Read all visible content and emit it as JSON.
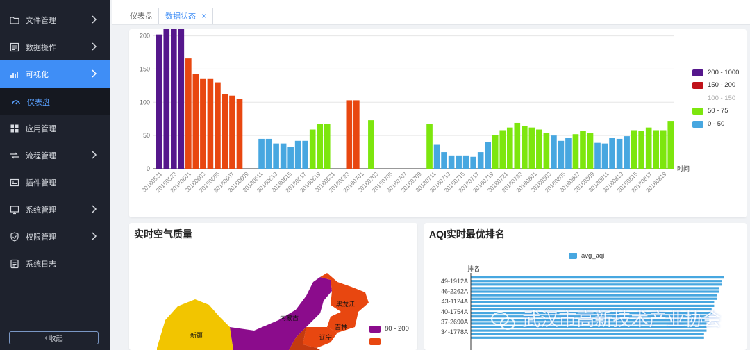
{
  "sidebar": {
    "items": [
      {
        "label": "文件管理",
        "icon": "folder-icon",
        "has_children": true
      },
      {
        "label": "数据操作",
        "icon": "data-op-icon",
        "has_children": true
      },
      {
        "label": "可视化",
        "icon": "bar-chart-icon",
        "has_children": true
      },
      {
        "label": "仪表盘",
        "icon": "dashboard-icon",
        "has_children": false
      },
      {
        "label": "应用管理",
        "icon": "grid-icon",
        "has_children": false
      },
      {
        "label": "流程管理",
        "icon": "flow-icon",
        "has_children": true
      },
      {
        "label": "插件管理",
        "icon": "plugin-icon",
        "has_children": false
      },
      {
        "label": "系统管理",
        "icon": "monitor-icon",
        "has_children": true
      },
      {
        "label": "权限管理",
        "icon": "shield-icon",
        "has_children": true
      },
      {
        "label": "系统日志",
        "icon": "log-icon",
        "has_children": false
      }
    ],
    "collapse_label": "收起"
  },
  "tabs": [
    {
      "label": "仪表盘",
      "active": false
    },
    {
      "label": "数据状态",
      "active": true,
      "close": "×"
    }
  ],
  "top_chart": {
    "x_axis_name": "时间",
    "legend": [
      {
        "label": "200 - 1000",
        "color": "#55178c"
      },
      {
        "label": "150 - 200",
        "color": "#c0121a"
      },
      {
        "label": "100 - 150",
        "color": "",
        "dimmed": true
      },
      {
        "label": "50 - 75",
        "color": "#7de60e"
      },
      {
        "label": "0 - 50",
        "color": "#47a7e0"
      }
    ]
  },
  "chart_data": {
    "type": "bar",
    "ylim": [
      0,
      210
    ],
    "yticks": [
      0,
      50,
      100,
      150,
      200
    ],
    "xlabel": "时间",
    "grid": true,
    "legend_position": "right",
    "xtick_labels": [
      "20180521",
      "20180523",
      "20180601",
      "20180603",
      "20180605",
      "20180607",
      "20180609",
      "20180611",
      "20180613",
      "20180615",
      "20180617",
      "20180619",
      "20180621",
      "20180623",
      "20180701",
      "20180703",
      "20180705",
      "20180707",
      "20180709",
      "20180711",
      "20180713",
      "20180715",
      "20180717",
      "20180719",
      "20180721",
      "20180723",
      "20180801",
      "20180803",
      "20180805",
      "20180807",
      "20180809",
      "20180811",
      "20180813",
      "20180815",
      "20180817",
      "20180819"
    ],
    "values": [
      202,
      214,
      214,
      213,
      166,
      143,
      135,
      135,
      130,
      112,
      110,
      105,
      null,
      null,
      45,
      45,
      38,
      38,
      33,
      42,
      42,
      59,
      67,
      67,
      null,
      null,
      103,
      103,
      null,
      73,
      null,
      null,
      null,
      null,
      null,
      null,
      null,
      67,
      36,
      25,
      20,
      20,
      20,
      18,
      25,
      40,
      51,
      58,
      62,
      69,
      64,
      62,
      59,
      54,
      50,
      42,
      46,
      52,
      57,
      54,
      39,
      38,
      47,
      45,
      49,
      58,
      57,
      62,
      58,
      58,
      72
    ],
    "bar_colors": [
      "#55178c",
      "#55178c",
      "#55178c",
      "#55178c",
      "#e84710",
      "#e84710",
      "#e84710",
      "#e84710",
      "#e84710",
      "#e84710",
      "#e84710",
      "#e84710",
      null,
      null,
      "#47a7e0",
      "#47a7e0",
      "#47a7e0",
      "#47a7e0",
      "#47a7e0",
      "#47a7e0",
      "#47a7e0",
      "#7de60e",
      "#7de60e",
      "#7de60e",
      null,
      null,
      "#e84710",
      "#e84710",
      null,
      "#7de60e",
      null,
      null,
      null,
      null,
      null,
      null,
      null,
      "#7de60e",
      "#47a7e0",
      "#47a7e0",
      "#47a7e0",
      "#47a7e0",
      "#47a7e0",
      "#47a7e0",
      "#47a7e0",
      "#47a7e0",
      "#7de60e",
      "#7de60e",
      "#7de60e",
      "#7de60e",
      "#7de60e",
      "#7de60e",
      "#7de60e",
      "#7de60e",
      "#47a7e0",
      "#47a7e0",
      "#47a7e0",
      "#7de60e",
      "#7de60e",
      "#7de60e",
      "#47a7e0",
      "#47a7e0",
      "#47a7e0",
      "#47a7e0",
      "#47a7e0",
      "#7de60e",
      "#7de60e",
      "#7de60e",
      "#7de60e",
      "#7de60e",
      "#7de60e"
    ]
  },
  "map_panel": {
    "title": "实时空气质量",
    "region_labels": [
      "黑龙江",
      "内蒙古",
      "吉林",
      "新疆",
      "辽宁"
    ],
    "legend": [
      {
        "label": "80 - 200",
        "color": "#8b0c8c"
      },
      {
        "label": "",
        "color": "#e84710"
      }
    ]
  },
  "rank_panel": {
    "title": "AQI实时最优排名",
    "legend_label": "avg_aqi",
    "y_axis_name": "排名",
    "row_labels": [
      "49-1912A",
      "46-2262A",
      "43-1124A",
      "40-1754A",
      "37-2690A",
      "34-1778A"
    ],
    "bar_fractions": [
      1.0,
      0.99,
      0.99,
      0.98,
      0.98,
      0.97,
      0.97,
      0.96,
      0.96,
      0.95,
      0.95,
      0.94,
      0.94,
      0.93,
      0.93,
      0.93,
      0.92,
      0.92
    ]
  },
  "watermark": "武汉市高新技术产业协会",
  "colors": {
    "accent": "#3f8ef6",
    "sidebar_bg": "#1e222d"
  }
}
